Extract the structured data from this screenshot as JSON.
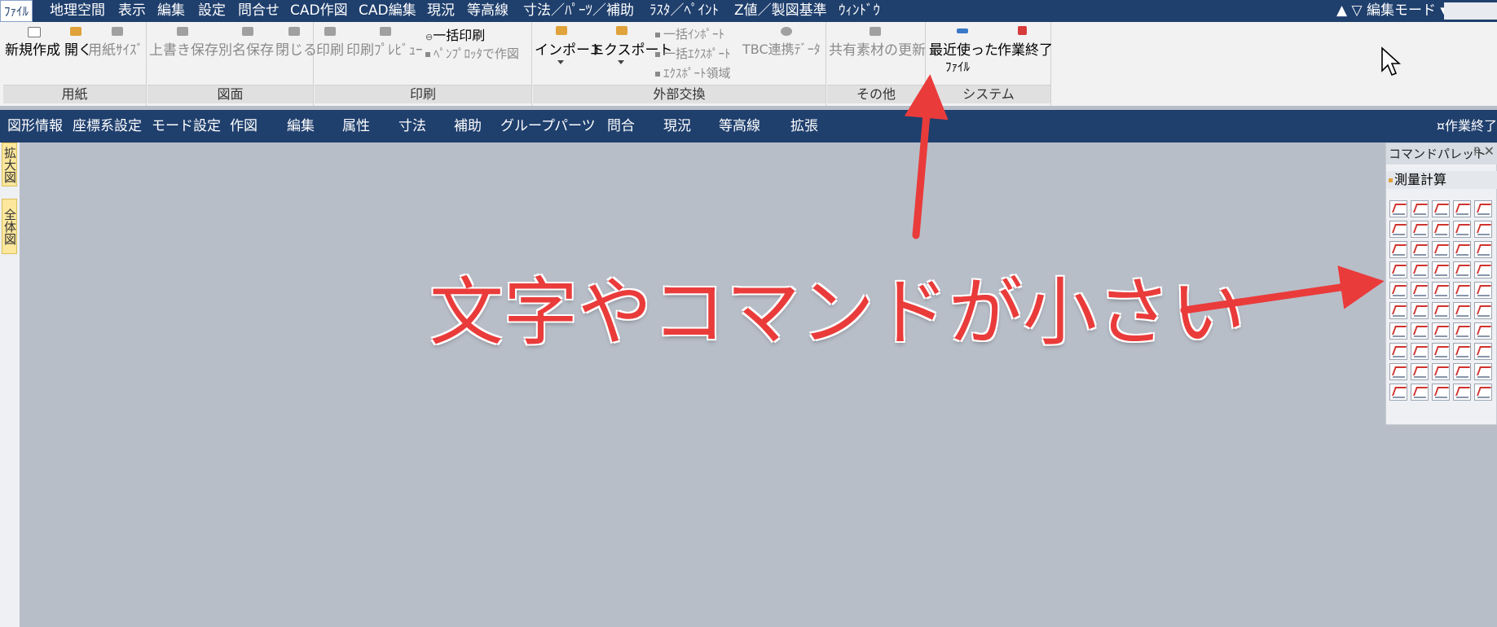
{
  "menubar": {
    "items": [
      "ﾌｧｲﾙ",
      "地理空間",
      "表示",
      "編集",
      "設定",
      "問合せ",
      "CAD作図",
      "CAD編集",
      "現況",
      "等高線",
      "寸法／ﾊﾟｰﾂ／補助",
      "ﾗｽﾀ／ﾍﾟｲﾝﾄ",
      "Z値／製図基準",
      "ｳｨﾝﾄﾞｳ"
    ],
    "mode_dropdown": "▲ ▽ 編集モード ▾"
  },
  "ribbon": {
    "groups": {
      "paper": {
        "label": "用紙",
        "new": "新規作成",
        "open": "開く",
        "paper_size": "用紙ｻｲｽﾞ"
      },
      "drawing": {
        "label": "図面",
        "overwrite": "上書き保存",
        "save_as": "別名保存",
        "close": "閉じる"
      },
      "print": {
        "label": "印刷",
        "print": "印刷",
        "preview": "印刷ﾌﾟﾚﾋﾞｭｰ",
        "batch_print": "一括印刷",
        "pen_plotter": "ﾍﾟﾝﾌﾟﾛｯﾀで作図"
      },
      "external": {
        "label": "外部交換",
        "import": "インポート",
        "export": "エクスポート",
        "batch_import": "一括ｲﾝﾎﾟｰﾄ",
        "batch_export": "一括ｴｸｽﾎﾟｰﾄ",
        "export_area": "ｴｸｽﾎﾟｰﾄ領域",
        "tbc": "TBC連携ﾃﾞｰﾀ"
      },
      "other": {
        "label": "その他",
        "shared_update": "共有素材の更新"
      },
      "system": {
        "label": "システム",
        "recent_1": "最近使った",
        "recent_2": "ﾌｧｲﾙ",
        "quit": "作業終了"
      }
    }
  },
  "toolbar": {
    "items": [
      "図形情報",
      "座標系設定",
      "モード設定",
      "作図",
      "編集",
      "属性",
      "寸法",
      "補助",
      "グループ",
      "パーツ",
      "問合",
      "現況",
      "等高線",
      "拡張"
    ],
    "end_label": "¤作業終了"
  },
  "left_tabs": [
    "拡大図",
    "全体図"
  ],
  "palette": {
    "title": "コマンドパレット",
    "pin": "ᵽ",
    "close": "✕",
    "section": "測量計算"
  },
  "annotation": {
    "text": "文字やコマンドが小さい",
    "color": "#ea3b3b"
  },
  "colors": {
    "menubar_bg": "#1f3f6d",
    "canvas_bg": "#b8bec8",
    "ribbon_bg": "#f2f2f2"
  }
}
